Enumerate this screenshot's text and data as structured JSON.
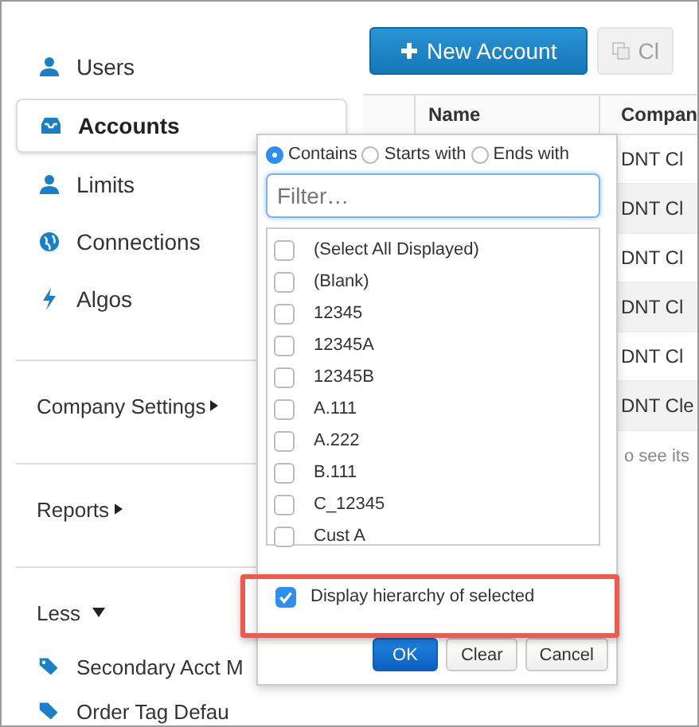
{
  "sidebar": {
    "nav_items": [
      {
        "label": "Users",
        "selected": false
      },
      {
        "label": "Accounts",
        "selected": true
      },
      {
        "label": "Limits",
        "selected": false
      },
      {
        "label": "Connections",
        "selected": false
      },
      {
        "label": "Algos",
        "selected": false
      }
    ],
    "menus": [
      "Company Settings",
      "Reports"
    ],
    "less": "Less",
    "more_items": [
      {
        "label": "Secondary Acct M"
      },
      {
        "label": "Order Tag Defau"
      }
    ]
  },
  "toolbar": {
    "buttons": [
      {
        "label": "New Account",
        "kind": "add",
        "disabled": false
      },
      {
        "label": "Cl",
        "kind": "copy",
        "disabled": true
      }
    ]
  },
  "table": {
    "columns": [
      "Name",
      "Compan"
    ],
    "rows": [
      {
        "column_3": "DNT Cl"
      },
      {
        "column_3": "DNT Cl"
      },
      {
        "column_3": "DNT Cl"
      },
      {
        "column_3": "DNT Cl"
      },
      {
        "column_3": "DNT Cl"
      },
      {
        "column_3": "DNT Cle"
      }
    ],
    "hint": "o see its"
  },
  "filter_popup": {
    "match_modes": [
      {
        "label": "Contains",
        "selected": true
      },
      {
        "label": "Starts with",
        "selected": false
      },
      {
        "label": "Ends with",
        "selected": false
      }
    ],
    "placeholder": "Filter…",
    "options": [
      {
        "label": "(Select All Displayed)",
        "checked": false
      },
      {
        "label": "(Blank)",
        "checked": false
      },
      {
        "label": "12345",
        "checked": false
      },
      {
        "label": "12345A",
        "checked": false
      },
      {
        "label": "12345B",
        "checked": false
      },
      {
        "label": "A.111",
        "checked": false
      },
      {
        "label": "A.222",
        "checked": false
      },
      {
        "label": "B.111",
        "checked": false
      },
      {
        "label": "C_12345",
        "checked": false
      },
      {
        "label": "Cust A",
        "checked": false
      }
    ],
    "hierarchy": {
      "label": "Display hierarchy of selected",
      "checked": true,
      "highlighted": true
    },
    "buttons": [
      {
        "label": "OK",
        "kind": "primary"
      },
      {
        "label": "Clear",
        "kind": "default"
      },
      {
        "label": "Cancel",
        "kind": "default"
      }
    ]
  }
}
